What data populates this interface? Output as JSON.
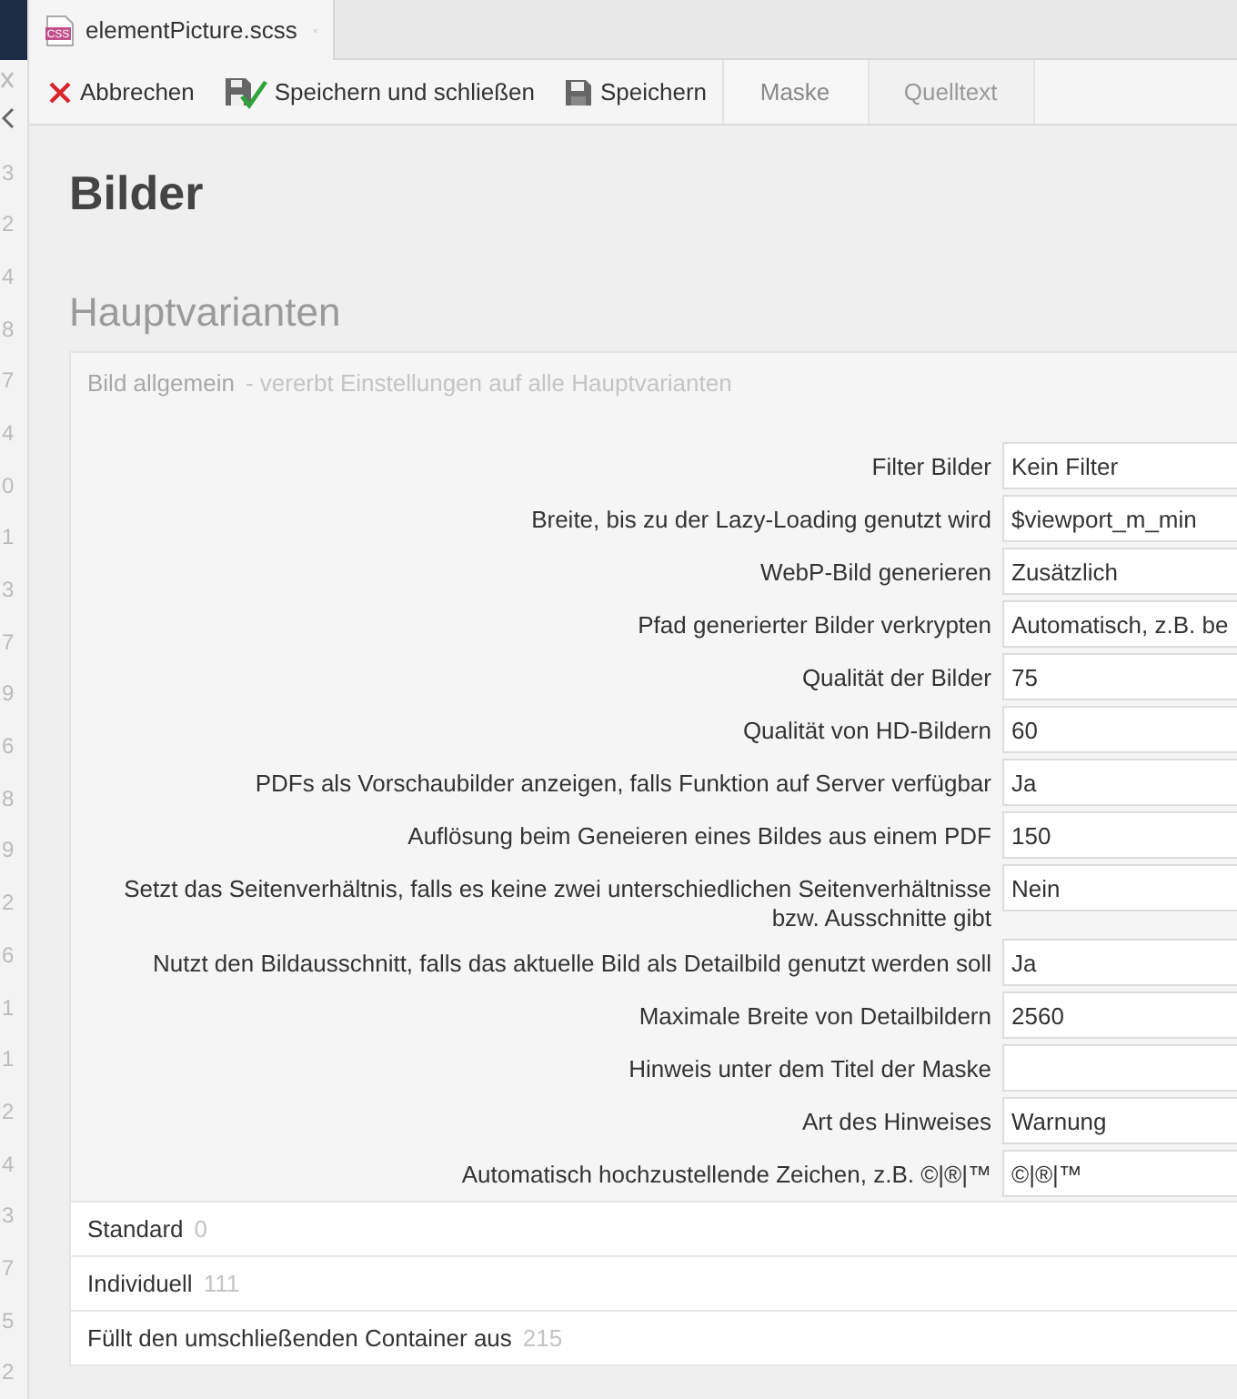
{
  "file_tab": {
    "label": "elementPicture.scss",
    "file_type": "CSS"
  },
  "toolbar": {
    "buttons": [
      {
        "label": "Abbrechen",
        "kind": "cancel"
      },
      {
        "label": "Speichern und schließen",
        "kind": "save_close"
      },
      {
        "label": "Speichern",
        "kind": "save"
      }
    ],
    "tabs": [
      {
        "label": "Maske",
        "selected": true
      },
      {
        "label": "Quelltext",
        "selected": false
      }
    ]
  },
  "gutter": {
    "line_numbers": [
      "3",
      "2",
      "4",
      "8",
      "7",
      "4",
      "0",
      "1",
      "3",
      "7",
      "9",
      "6",
      "8",
      "9",
      "2",
      "6",
      "1",
      "1",
      "2",
      "4",
      "3",
      "7",
      "5",
      "2"
    ]
  },
  "title": "Bilder",
  "section_title": "Hauptvarianten",
  "panel": {
    "title": "Bild allgemein",
    "subtitle": "- vererbt Einstellungen auf alle Hauptvarianten",
    "fields": [
      {
        "label": "Filter Bilder",
        "value": "Kein Filter"
      },
      {
        "label": "Breite, bis zu der Lazy-Loading genutzt wird",
        "value": "$viewport_m_min"
      },
      {
        "label": "WebP-Bild generieren",
        "value": "Zusätzlich"
      },
      {
        "label": "Pfad generierter Bilder verkrypten",
        "value": "Automatisch, z.B. be"
      },
      {
        "label": "Qualität der Bilder",
        "value": "75"
      },
      {
        "label": "Qualität von HD-Bildern",
        "value": "60"
      },
      {
        "label": "PDFs als Vorschaubilder anzeigen, falls Funktion auf Server verfügbar",
        "value": "Ja"
      },
      {
        "label": "Auflösung beim Geneieren eines Bildes aus einem PDF",
        "value": "150"
      },
      {
        "label": "Setzt das Seitenverhältnis, falls es keine zwei unterschiedlichen Seitenverhältnisse bzw. Ausschnitte gibt",
        "value": "Nein"
      },
      {
        "label": "Nutzt den Bildausschnitt, falls das aktuelle Bild als Detailbild genutzt werden soll",
        "value": "Ja"
      },
      {
        "label": "Maximale Breite von Detailbildern",
        "value": "2560"
      },
      {
        "label": "Hinweis unter dem Titel der Maske"
      },
      {
        "label": "Art des Hinweises",
        "value": "Warnung"
      },
      {
        "label": "Automatisch hochzustellende Zeichen, z.B. ©|®|™",
        "value": "©|®|™"
      }
    ]
  },
  "variants": [
    {
      "label": "Standard",
      "count": "0"
    },
    {
      "label": "Individuell",
      "count": "111"
    },
    {
      "label": "Füllt den umschließenden Container aus",
      "count": "215"
    }
  ]
}
